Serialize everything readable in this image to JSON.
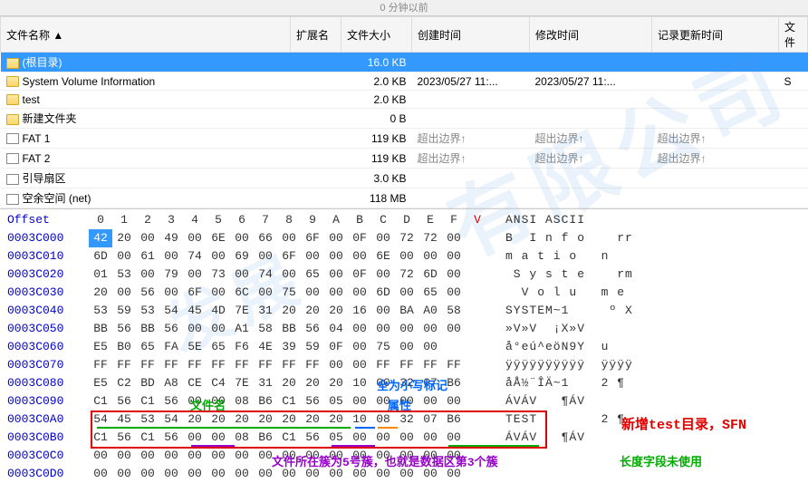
{
  "topbar": {
    "text": "0 分钟以前"
  },
  "columns": {
    "name": "文件名称",
    "ext": "扩展名",
    "size": "文件大小",
    "created": "创建时间",
    "modified": "修改时间",
    "recorded": "记录更新时间",
    "attr": "文件"
  },
  "rows": [
    {
      "name": "(根目录)",
      "ext": "",
      "size": "16.0 KB",
      "created": "",
      "modified": "",
      "recorded": "",
      "attr": "",
      "icon": "folder",
      "selected": true
    },
    {
      "name": "System Volume Information",
      "ext": "",
      "size": "2.0 KB",
      "created": "2023/05/27  11:...",
      "modified": "2023/05/27  11:...",
      "recorded": "",
      "attr": "S",
      "icon": "folder"
    },
    {
      "name": "test",
      "ext": "",
      "size": "2.0 KB",
      "created": "",
      "modified": "",
      "recorded": "",
      "attr": "",
      "icon": "folder"
    },
    {
      "name": "新建文件夹",
      "ext": "",
      "size": "0 B",
      "created": "",
      "modified": "",
      "recorded": "",
      "attr": "",
      "icon": "folder"
    },
    {
      "name": "FAT 1",
      "ext": "",
      "size": "119 KB",
      "created": "超出边界↑",
      "modified": "超出边界↑",
      "recorded": "超出边界↑",
      "attr": "",
      "icon": "file",
      "gray": true
    },
    {
      "name": "FAT 2",
      "ext": "",
      "size": "119 KB",
      "created": "超出边界↑",
      "modified": "超出边界↑",
      "recorded": "超出边界↑",
      "attr": "",
      "icon": "file",
      "gray": true
    },
    {
      "name": "引导扇区",
      "ext": "",
      "size": "3.0 KB",
      "created": "",
      "modified": "",
      "recorded": "",
      "attr": "",
      "icon": "file"
    },
    {
      "name": "空余空间 (net)",
      "ext": "",
      "size": "118 MB",
      "created": "",
      "modified": "",
      "recorded": "",
      "attr": "",
      "icon": "file"
    }
  ],
  "hex": {
    "header_offset": "Offset",
    "header_cols": [
      "0",
      "1",
      "2",
      "3",
      "4",
      "5",
      "6",
      "7",
      "8",
      "9",
      "A",
      "B",
      "C",
      "D",
      "E",
      "F"
    ],
    "header_v": "V",
    "header_ascii": "ANSI ASCII",
    "rows": [
      {
        "off": "0003C000",
        "b": [
          "42",
          "20",
          "00",
          "49",
          "00",
          "6E",
          "00",
          "66",
          "00",
          "6F",
          "00",
          "0F",
          "00",
          "72",
          "72",
          "00"
        ],
        "a": "B  I n f o    rr"
      },
      {
        "off": "0003C010",
        "b": [
          "6D",
          "00",
          "61",
          "00",
          "74",
          "00",
          "69",
          "00",
          "6F",
          "00",
          "00",
          "00",
          "6E",
          "00",
          "00",
          "00"
        ],
        "a": "m a t i o   n"
      },
      {
        "off": "0003C020",
        "b": [
          "01",
          "53",
          "00",
          "79",
          "00",
          "73",
          "00",
          "74",
          "00",
          "65",
          "00",
          "0F",
          "00",
          "72",
          "6D",
          "00"
        ],
        "a": " S y s t e    rm"
      },
      {
        "off": "0003C030",
        "b": [
          "20",
          "00",
          "56",
          "00",
          "6F",
          "00",
          "6C",
          "00",
          "75",
          "00",
          "00",
          "00",
          "6D",
          "00",
          "65",
          "00"
        ],
        "a": "  V o l u   m e"
      },
      {
        "off": "0003C040",
        "b": [
          "53",
          "59",
          "53",
          "54",
          "45",
          "4D",
          "7E",
          "31",
          "20",
          "20",
          "20",
          "16",
          "00",
          "BA",
          "A0",
          "58"
        ],
        "a": "SYSTEM~1     º X"
      },
      {
        "off": "0003C050",
        "b": [
          "BB",
          "56",
          "BB",
          "56",
          "00",
          "00",
          "A1",
          "58",
          "BB",
          "56",
          "04",
          "00",
          "00",
          "00",
          "00",
          "00"
        ],
        "a": "»V»V  ¡X»V"
      },
      {
        "off": "0003C060",
        "b": [
          "E5",
          "B0",
          "65",
          "FA",
          "5E",
          "65",
          "F6",
          "4E",
          "39",
          "59",
          "0F",
          "00",
          "75",
          "00",
          "00",
          " "
        ],
        "a": "å°eú^eöN9Y  u"
      },
      {
        "off": "0003C070",
        "b": [
          "FF",
          "FF",
          "FF",
          "FF",
          "FF",
          "FF",
          "FF",
          "FF",
          "FF",
          "FF",
          "00",
          "00",
          "FF",
          "FF",
          "FF",
          "FF"
        ],
        "a": "ÿÿÿÿÿÿÿÿÿÿ  ÿÿÿÿ"
      },
      {
        "off": "0003C080",
        "b": [
          "E5",
          "C2",
          "BD",
          "A8",
          "CE",
          "C4",
          "7E",
          "31",
          "20",
          "20",
          "20",
          "10",
          "00",
          "32",
          "07",
          "B6"
        ],
        "a": "åÅ½¨ÎÄ~1    2 ¶"
      },
      {
        "off": "0003C090",
        "b": [
          "C1",
          "56",
          "C1",
          "56",
          "00",
          "00",
          "08",
          "B6",
          "C1",
          "56",
          "05",
          "00",
          "00",
          "00",
          "00",
          "00"
        ],
        "a": "ÁVÁV   ¶ÁV"
      },
      {
        "off": "0003C0A0",
        "b": [
          "54",
          "45",
          "53",
          "54",
          "20",
          "20",
          "20",
          "20",
          "20",
          "20",
          "20",
          "10",
          "08",
          "32",
          "07",
          "B6"
        ],
        "a": "TEST        2 ¶"
      },
      {
        "off": "0003C0B0",
        "b": [
          "C1",
          "56",
          "C1",
          "56",
          "00",
          "00",
          "08",
          "B6",
          "C1",
          "56",
          "05",
          "00",
          "00",
          "00",
          "00",
          "00"
        ],
        "a": "ÁVÁV   ¶ÁV"
      },
      {
        "off": "0003C0C0",
        "b": [
          "00",
          "00",
          "00",
          "00",
          "00",
          "00",
          "00",
          "00",
          "00",
          "00",
          "00",
          "00",
          "00",
          "00",
          "00",
          "00"
        ],
        "a": ""
      },
      {
        "off": "0003C0D0",
        "b": [
          "00",
          "00",
          "00",
          "00",
          "00",
          "00",
          "00",
          "00",
          "00",
          "00",
          "00",
          "00",
          "00",
          "00",
          "00",
          "00"
        ],
        "a": ""
      }
    ]
  },
  "annotations": {
    "filename": "文件名",
    "attribute_top": "全为小写标记",
    "attribute": "属性",
    "sfn": "新增test目录，SFN",
    "cluster": "文件所在簇为5号簇，也就是数据区第3个簇",
    "length": "长度字段未使用"
  }
}
